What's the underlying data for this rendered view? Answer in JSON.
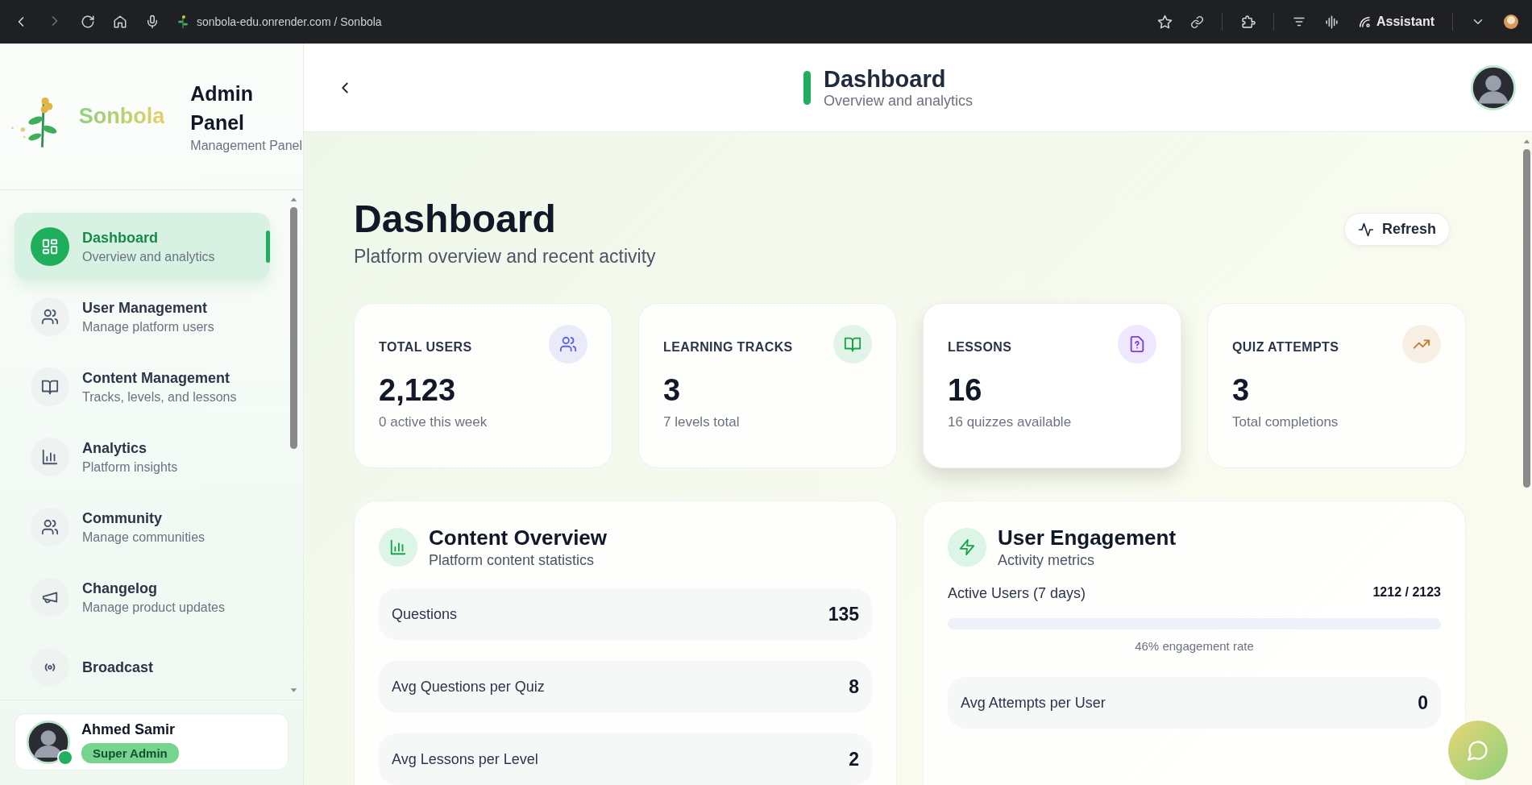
{
  "browser": {
    "address": "sonbola-edu.onrender.com / Sonbola",
    "assistant_label": "Assistant"
  },
  "sidebar": {
    "brand": "Sonbola",
    "panel_title": "Admin Panel",
    "panel_subtitle": "Management Panel",
    "items": [
      {
        "label": "Dashboard",
        "description": "Overview and analytics",
        "selected": true
      },
      {
        "label": "User Management",
        "description": "Manage platform users",
        "selected": false
      },
      {
        "label": "Content Management",
        "description": "Tracks, levels, and lessons",
        "selected": false
      },
      {
        "label": "Analytics",
        "description": "Platform insights",
        "selected": false
      },
      {
        "label": "Community",
        "description": "Manage communities",
        "selected": false
      },
      {
        "label": "Changelog",
        "description": "Manage product updates",
        "selected": false
      },
      {
        "label": "Broadcast",
        "selected": false
      }
    ],
    "user": {
      "name": "Ahmed Samir",
      "role": "Super Admin",
      "online": true
    }
  },
  "header": {
    "title": "Dashboard",
    "subtitle": "Overview and analytics"
  },
  "page": {
    "title": "Dashboard",
    "subtitle": "Platform overview and recent activity",
    "refresh_label": "Refresh"
  },
  "stats": [
    {
      "label": "TOTAL USERS",
      "value": "2,123",
      "note": "0 active this week",
      "color": "#5b63e6",
      "raised": false
    },
    {
      "label": "LEARNING TRACKS",
      "value": "3",
      "note": "7 levels total",
      "color": "#16a34a",
      "raised": false
    },
    {
      "label": "LESSONS",
      "value": "16",
      "note": "16 quizzes available",
      "color": "#7c3aed",
      "raised": true
    },
    {
      "label": "QUIZ ATTEMPTS",
      "value": "3",
      "note": "Total completions",
      "color": "#c27a2c",
      "raised": false
    }
  ],
  "content_overview": {
    "title": "Content Overview",
    "subtitle": "Platform content statistics",
    "rows": [
      {
        "label": "Questions",
        "value": "135"
      },
      {
        "label": "Avg Questions per Quiz",
        "value": "8"
      },
      {
        "label": "Avg Lessons per Level",
        "value": "2"
      }
    ]
  },
  "engagement": {
    "title": "User Engagement",
    "subtitle": "Activity metrics",
    "active_label": "Active Users (7 days)",
    "active_value": "1212 / 2123",
    "level": 0,
    "rate": "46% engagement rate",
    "rows": [
      {
        "label": "Avg Attempts per User",
        "value": "0"
      }
    ]
  }
}
